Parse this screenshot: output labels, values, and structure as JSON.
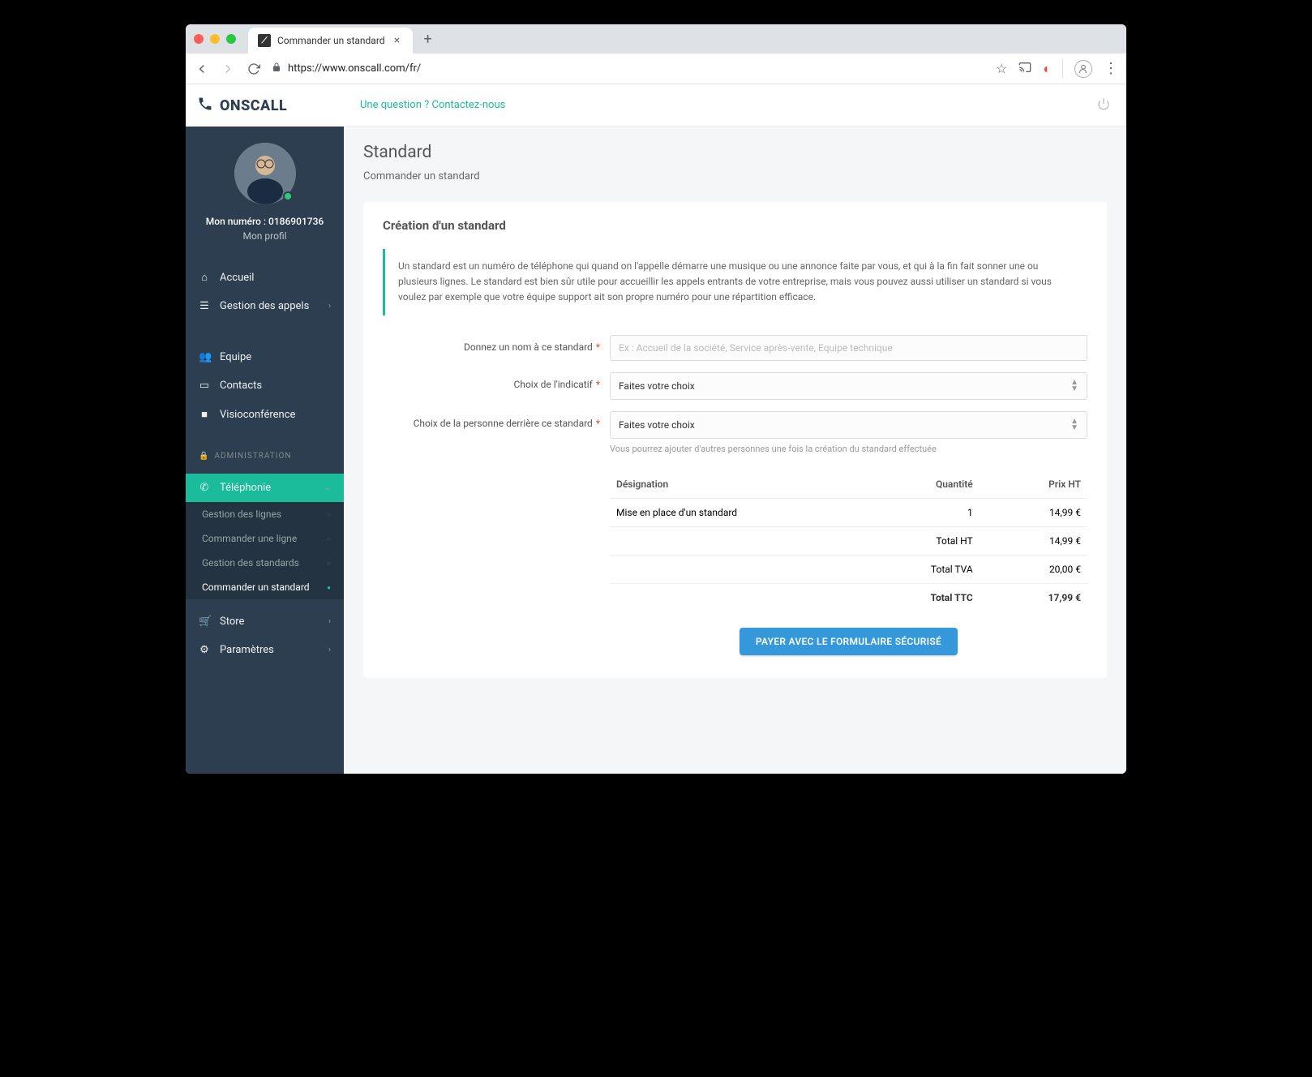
{
  "browser": {
    "tab_title": "Commander un standard",
    "url": "https://www.onscall.com/fr/"
  },
  "brand": "ONSCALL",
  "topbar": {
    "contact": "Une question ? Contactez-nous"
  },
  "profile": {
    "number_label": "Mon numéro :",
    "number": "0186901736",
    "profile_link": "Mon profil"
  },
  "nav": {
    "accueil": "Accueil",
    "gestion_appels": "Gestion des appels",
    "equipe": "Equipe",
    "contacts": "Contacts",
    "visio": "Visioconférence",
    "admin_header": "ADMINISTRATION",
    "telephonie": "Téléphonie",
    "sub": {
      "gestion_lignes": "Gestion des lignes",
      "commander_ligne": "Commander une ligne",
      "gestion_standards": "Gestion des standards",
      "commander_standard": "Commander un standard"
    },
    "store": "Store",
    "parametres": "Paramètres"
  },
  "page": {
    "title": "Standard",
    "subtitle": "Commander un standard",
    "card_title": "Création d'un standard",
    "info": "Un standard est un numéro de téléphone qui quand on l'appelle démarre une musique ou une annonce faite par vous, et qui à la fin fait sonner une ou plusieurs lignes. Le standard est bien sûr utile pour accueillir les appels entrants de votre entreprise, mais vous pouvez aussi utiliser un standard si vous voulez par exemple que votre équipe support ait son propre numéro pour une répartition efficace.",
    "form": {
      "name_label": "Donnez un nom à ce standard",
      "name_placeholder": "Ex : Accueil de la société, Service après-vente, Equipe technique",
      "indicatif_label": "Choix de l'indicatif",
      "indicatif_value": "Faites votre choix",
      "person_label": "Choix de la personne derrière ce standard",
      "person_value": "Faites votre choix",
      "person_hint": "Vous pourrez ajouter d'autres personnes une fois la création du standard effectuée"
    },
    "table": {
      "h_designation": "Désignation",
      "h_quantite": "Quantité",
      "h_prix": "Prix HT",
      "row_designation": "Mise en place d'un standard",
      "row_qty": "1",
      "row_price": "14,99 €",
      "total_ht_label": "Total HT",
      "total_ht": "14,99 €",
      "total_tva_label": "Total TVA",
      "total_tva": "20,00 €",
      "total_ttc_label": "Total TTC",
      "total_ttc": "17,99 €"
    },
    "pay_button": "PAYER AVEC LE FORMULAIRE SÉCURISÉ"
  }
}
